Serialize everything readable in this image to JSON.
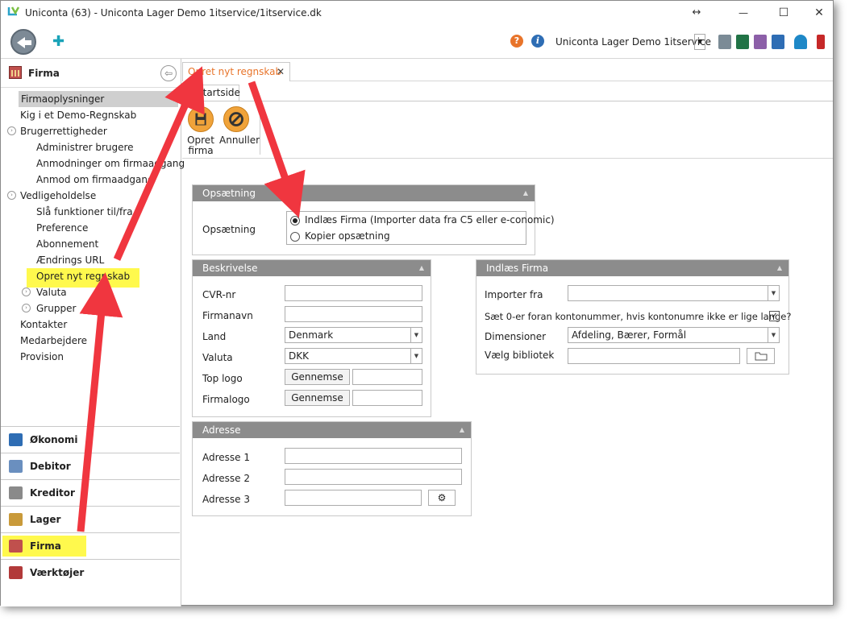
{
  "window": {
    "title": "Uniconta (63)  - Uniconta Lager Demo 1itservice/1itservice.dk",
    "resize_glyph": "↔",
    "minimize": "—",
    "maximize": "☐",
    "close": "✕"
  },
  "toolbar": {
    "company": "Uniconta Lager Demo 1itservice",
    "plus": "✚",
    "help": "?",
    "info": "i",
    "dd": "▼",
    "icons": [
      "print-icon",
      "excel-icon",
      "csv-icon",
      "copy-icon",
      "user-icon"
    ]
  },
  "sidebar": {
    "header": "Firma",
    "collapse": "⇦",
    "tree": [
      {
        "label": "Firmaoplysninger",
        "indent": 0,
        "selected": true
      },
      {
        "label": "Kig i et Demo-Regnskab",
        "indent": 0
      },
      {
        "label": "Brugerrettigheder",
        "indent": 0,
        "expander": true
      },
      {
        "label": "Administrer brugere",
        "indent": 1
      },
      {
        "label": "Anmodninger om firmaadgang",
        "indent": 1
      },
      {
        "label": "Anmod om firmaadgang",
        "indent": 1
      },
      {
        "label": "Vedligeholdelse",
        "indent": 0,
        "expander": true
      },
      {
        "label": "Slå funktioner til/fra",
        "indent": 1
      },
      {
        "label": "Preference",
        "indent": 1
      },
      {
        "label": "Abonnement",
        "indent": 1
      },
      {
        "label": "Ændrings URL",
        "indent": 1
      },
      {
        "label": "Opret nyt regnskab",
        "indent": 1,
        "highlight": true
      },
      {
        "label": "Valuta",
        "indent": 1,
        "expander": true
      },
      {
        "label": "Grupper",
        "indent": 1,
        "expander": true
      },
      {
        "label": "Kontakter",
        "indent": 0
      },
      {
        "label": "Medarbejdere",
        "indent": 0
      },
      {
        "label": "Provision",
        "indent": 0
      }
    ],
    "modules": [
      {
        "label": "Økonomi",
        "color": "#2e6db4"
      },
      {
        "label": "Debitor",
        "color": "#6a8fbf"
      },
      {
        "label": "Kreditor",
        "color": "#8a8a8a"
      },
      {
        "label": "Lager",
        "color": "#c99a3a"
      },
      {
        "label": "Firma",
        "color": "#c0504d",
        "highlight": true
      },
      {
        "label": "Værktøjer",
        "color": "#b23a3a"
      }
    ]
  },
  "tab": {
    "label": "Opret nyt regnskab",
    "close": "✕"
  },
  "ribbon": {
    "tab": "Startside",
    "buttons": [
      {
        "label": "Opret firma",
        "icon": "save-icon"
      },
      {
        "label": "Annuller",
        "icon": "cancel-icon"
      }
    ]
  },
  "opsaetning": {
    "header": "Opsætning",
    "label": "Opsætning",
    "options": [
      "Indlæs Firma (Importer data fra C5 eller e-conomic)",
      "Kopier opsætning"
    ],
    "selected": 0
  },
  "beskrivelse": {
    "header": "Beskrivelse",
    "fields": {
      "cvr": "CVR-nr",
      "firmanavn": "Firmanavn",
      "land": "Land",
      "valuta": "Valuta",
      "toplogo": "Top logo",
      "firmalogo": "Firmalogo"
    },
    "land_value": "Denmark",
    "valuta_value": "DKK",
    "browse": "Gennemse"
  },
  "adresse": {
    "header": "Adresse",
    "fields": [
      "Adresse 1",
      "Adresse 2",
      "Adresse 3"
    ],
    "gear": "⚙"
  },
  "indlaes": {
    "header": "Indlæs Firma",
    "importer": "Importer fra",
    "saet": "Sæt 0-er foran kontonummer, hvis kontonumre ikke er lige lange?",
    "saet_checked": true,
    "dimensioner": "Dimensioner",
    "dimensioner_value": "Afdeling, Bærer, Formål",
    "bibliotek": "Vælg bibliotek"
  },
  "colors": {
    "accent": "#e8742a",
    "group_header": "#8c8c8c",
    "highlight": "#fff94d",
    "arrow": "#f0363f"
  }
}
